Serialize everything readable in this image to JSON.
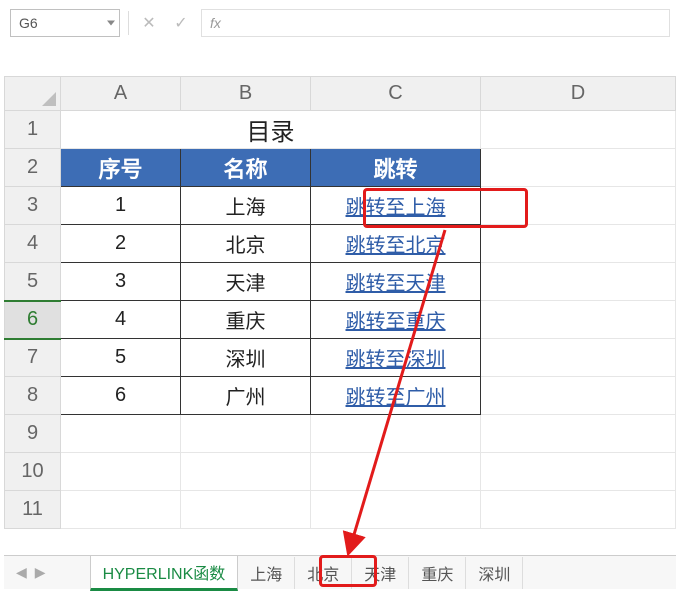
{
  "name_box": "G6",
  "fx_label": "fx",
  "columns": [
    "A",
    "B",
    "C",
    "D"
  ],
  "row_numbers": [
    "1",
    "2",
    "3",
    "4",
    "5",
    "6",
    "7",
    "8",
    "9",
    "10",
    "11"
  ],
  "selected_row": "6",
  "title": "目录",
  "headers": {
    "seq": "序号",
    "name": "名称",
    "jump": "跳转"
  },
  "rows": [
    {
      "seq": "1",
      "name": "上海",
      "jump": "跳转至上海"
    },
    {
      "seq": "2",
      "name": "北京",
      "jump": "跳转至北京"
    },
    {
      "seq": "3",
      "name": "天津",
      "jump": "跳转至天津"
    },
    {
      "seq": "4",
      "name": "重庆",
      "jump": "跳转至重庆"
    },
    {
      "seq": "5",
      "name": "深圳",
      "jump": "跳转至深圳"
    },
    {
      "seq": "6",
      "name": "广州",
      "jump": "跳转至广州"
    }
  ],
  "tabs": {
    "active": "HYPERLINK函数",
    "others": [
      "上海",
      "北京",
      "天津",
      "重庆",
      "深圳"
    ]
  },
  "annotation": {
    "highlight_link_row": 0,
    "highlight_tab": "上海",
    "color": "#e21b1b"
  }
}
